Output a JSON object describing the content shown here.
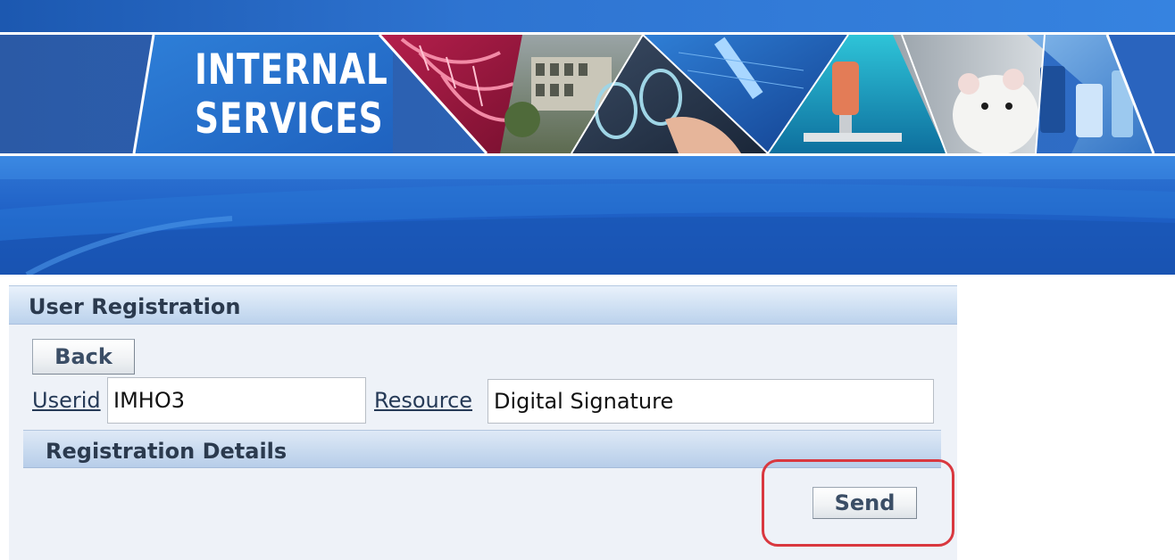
{
  "banner": {
    "logo_line1": "INTERNAL",
    "logo_line2": "SERVICES",
    "images": [
      "dna-image",
      "building-image",
      "brain-scan-image",
      "test-tube-image",
      "microscope-image",
      "lab-mouse-image",
      "lab-glassware-image"
    ]
  },
  "panel": {
    "title": "User Registration",
    "back_label": "Back",
    "userid_label": "Userid",
    "userid_value": "IMHO3",
    "resource_label": "Resource",
    "resource_value": "Digital Signature",
    "details_title": "Registration Details",
    "send_label": "Send"
  },
  "colors": {
    "banner_blue": "#1f5fb8",
    "panel_bg": "#eef2f8",
    "highlight": "#d9383f"
  }
}
